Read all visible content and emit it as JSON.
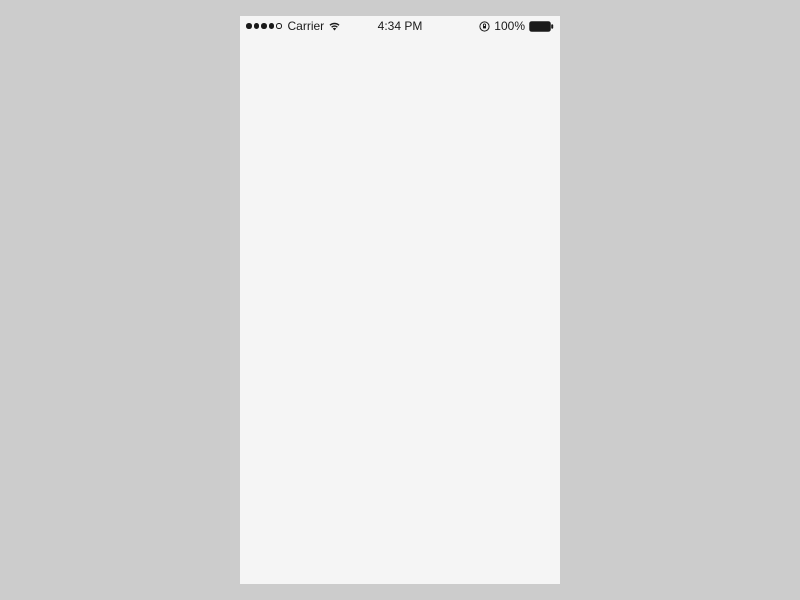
{
  "status_bar": {
    "carrier": "Carrier",
    "time": "4:34 PM",
    "battery_percent": "100%",
    "signal_strength": 4,
    "signal_max": 5
  }
}
